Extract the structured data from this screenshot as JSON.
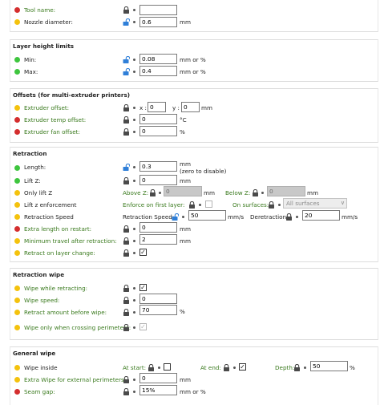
{
  "colors": {
    "accent": "#3ec53e",
    "simple": "#3ec53e",
    "advanced": "#f4c20d",
    "expert": "#d42e2e",
    "lock_blue": "#2f7fd8",
    "lock_grey": "#4a4a4a"
  },
  "general": {
    "tool_name": {
      "label": "Tool name:",
      "value": ""
    },
    "nozzle_diameter": {
      "label": "Nozzle diameter:",
      "value": "0.6",
      "unit": "mm"
    }
  },
  "layer_height": {
    "title": "Layer height limits",
    "min": {
      "label": "Min:",
      "value": "0.08",
      "unit": "mm or %"
    },
    "max": {
      "label": "Max:",
      "value": "0.4",
      "unit": "mm or %"
    }
  },
  "offsets": {
    "title": "Offsets (for multi-extruder printers)",
    "extruder_offset": {
      "label": "Extruder offset:",
      "x_label": "x :",
      "x_value": "0",
      "y_label": "y :",
      "y_value": "0",
      "unit": "mm"
    },
    "temp_offset": {
      "label": "Extruder temp offset:",
      "value": "0",
      "unit": "°C"
    },
    "fan_offset": {
      "label": "Extruder fan offset:",
      "value": "0",
      "unit": "%"
    }
  },
  "retraction": {
    "title": "Retraction",
    "length": {
      "label": "Length:",
      "value": "0.3",
      "unit": "mm",
      "unit2": "(zero to disable)"
    },
    "lift_z": {
      "label": "Lift Z:",
      "value": "0",
      "unit": "mm"
    },
    "only_lift_z": {
      "label": "Only lift Z",
      "above_label": "Above Z:",
      "above_value": "0",
      "above_unit": "mm",
      "below_label": "Below Z:",
      "below_value": "0",
      "below_unit": "mm"
    },
    "lift_z_enforcement": {
      "label": "Lift z enforcement",
      "first_layer_label": "Enforce on first layer:",
      "surfaces_label": "On surfaces:",
      "surfaces_value": "All surfaces"
    },
    "retraction_speed": {
      "label": "Retraction Speed",
      "speed_label": "Retraction Speed:",
      "speed_value": "50",
      "speed_unit": "mm/s",
      "deretraction_label": "Deretraction:",
      "deretraction_value": "20",
      "deretraction_unit": "mm/s"
    },
    "extra_length": {
      "label": "Extra length on restart:",
      "value": "0",
      "unit": "mm"
    },
    "min_travel": {
      "label": "Minimum travel after retraction:",
      "value": "2",
      "unit": "mm"
    },
    "retract_layer_change": {
      "label": "Retract on layer change:",
      "checked": true
    }
  },
  "retraction_wipe": {
    "title": "Retraction wipe",
    "wipe_retracting": {
      "label": "Wipe while retracting:",
      "checked": true
    },
    "wipe_speed": {
      "label": "Wipe speed:",
      "value": "0"
    },
    "retract_before_wipe": {
      "label": "Retract amount before wipe:",
      "value": "70",
      "unit": "%"
    },
    "wipe_crossing": {
      "label": "Wipe only when crossing perimeters:",
      "checked": true
    }
  },
  "general_wipe": {
    "title": "General wipe",
    "wipe_inside": {
      "label": "Wipe inside",
      "at_start_label": "At start:",
      "at_start_checked": false,
      "at_end_label": "At end:",
      "at_end_checked": true,
      "depth_label": "Depth:",
      "depth_value": "50",
      "depth_unit": "%"
    },
    "extra_wipe": {
      "label": "Extra Wipe for external perimeters:",
      "value": "0",
      "unit": "mm"
    },
    "seam_gap": {
      "label": "Seam gap:",
      "value": "15%",
      "unit": "mm or %"
    }
  }
}
